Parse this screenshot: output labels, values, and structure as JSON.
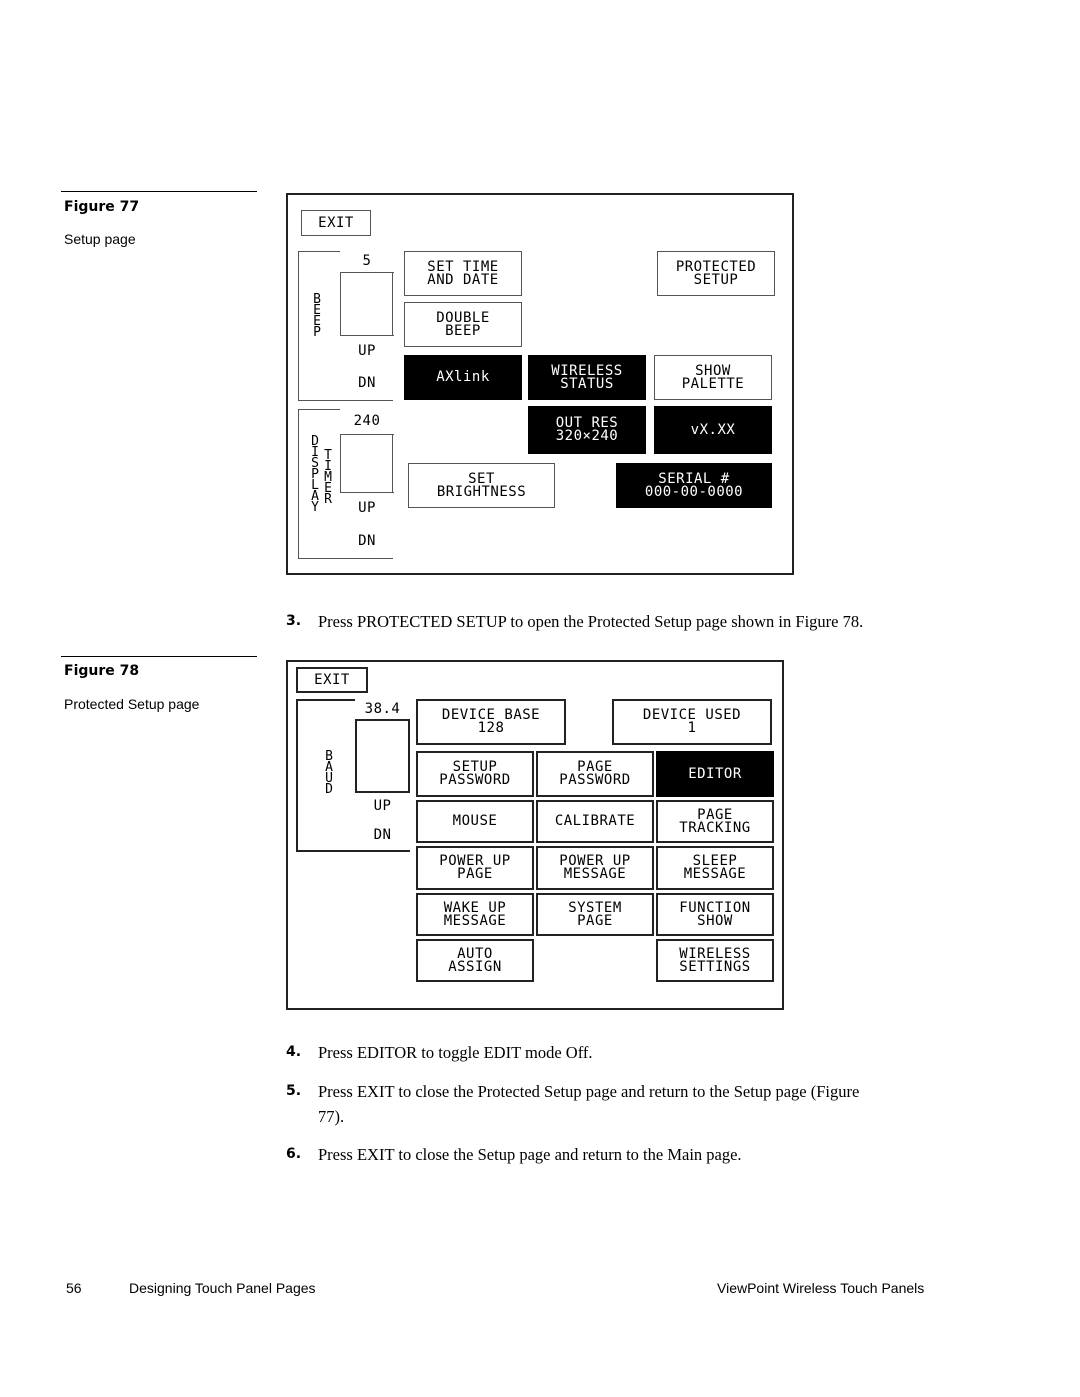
{
  "figure77": {
    "title": "Figure 77",
    "caption": "Setup page",
    "panel": {
      "exit": "EXIT",
      "beep": {
        "label": "BEEP",
        "value": "5",
        "up": "UP",
        "dn": "DN"
      },
      "display_timer": {
        "label1": "DISPLAY",
        "label2": "TIMER",
        "value": "240",
        "up": "UP",
        "dn": "DN"
      },
      "set_time_date": "SET TIME\nAND DATE",
      "double_beep": "DOUBLE\nBEEP",
      "protected_setup": "PROTECTED\nSETUP",
      "axlink": "AXlink",
      "wireless_status": "WIRELESS\nSTATUS",
      "show_palette": "SHOW\nPALETTE",
      "out_res": "OUT RES\n320×240",
      "version": "vX.XX",
      "set_brightness": "SET\nBRIGHTNESS",
      "serial": "SERIAL #\n000-00-0000"
    }
  },
  "step3": {
    "num": "3.",
    "text": "Press PROTECTED SETUP to open the Protected Setup page shown in Figure 78."
  },
  "figure78": {
    "title": "Figure 78",
    "caption": "Protected Setup page",
    "panel": {
      "exit": "EXIT",
      "baud": {
        "label": "BAUD",
        "value": "38.4",
        "up": "UP",
        "dn": "DN"
      },
      "device_base": "DEVICE BASE\n128",
      "device_used": "DEVICE USED\n1",
      "setup_password": "SETUP\nPASSWORD",
      "page_password": "PAGE\nPASSWORD",
      "editor": "EDITOR",
      "mouse": "MOUSE",
      "calibrate": "CALIBRATE",
      "page_tracking": "PAGE\nTRACKING",
      "power_up_page": "POWER UP\nPAGE",
      "power_up_message": "POWER UP\nMESSAGE",
      "sleep_message": "SLEEP\nMESSAGE",
      "wake_up_message": "WAKE UP\nMESSAGE",
      "system_page": "SYSTEM\nPAGE",
      "function_show": "FUNCTION\nSHOW",
      "auto_assign": "AUTO\nASSIGN",
      "wireless_settings": "WIRELESS\nSETTINGS"
    }
  },
  "steps": [
    {
      "num": "4.",
      "text": "Press EDITOR to toggle EDIT mode Off."
    },
    {
      "num": "5.",
      "text": "Press EXIT to close the Protected Setup page and return to the Setup page (Figure 77)."
    },
    {
      "num": "6.",
      "text": "Press EXIT to close the Setup page and return to the Main page."
    }
  ],
  "footer": {
    "page_number": "56",
    "section": "Designing Touch Panel Pages",
    "book": "ViewPoint Wireless Touch Panels"
  }
}
